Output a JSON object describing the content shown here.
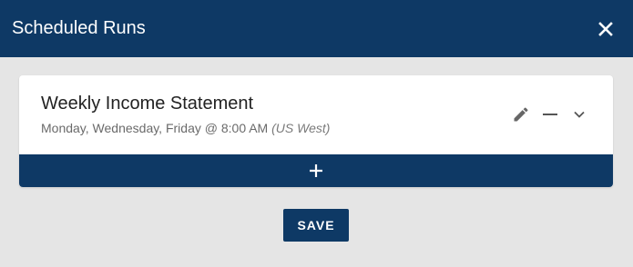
{
  "dialog": {
    "title": "Scheduled Runs",
    "close_icon": "close-icon"
  },
  "runs": [
    {
      "title": "Weekly Income Statement",
      "schedule": "Monday, Wednesday, Friday @ 8:00 AM",
      "timezone": "(US West)",
      "actions": [
        "edit-icon",
        "minus-icon",
        "chevron-down-icon"
      ]
    }
  ],
  "add_bar": {
    "icon": "plus-icon"
  },
  "footer": {
    "save_label": "SAVE"
  },
  "colors": {
    "primary": "#0e3965",
    "background": "#e5e5e5",
    "card": "#ffffff"
  }
}
